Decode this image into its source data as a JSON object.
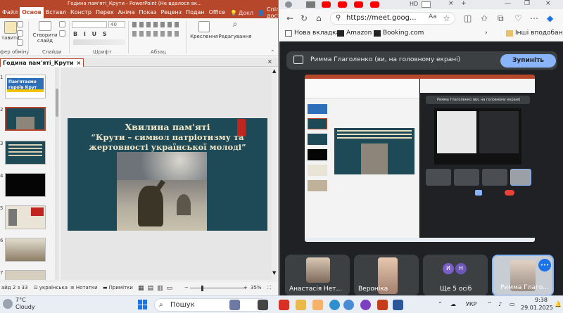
{
  "powerpoint": {
    "window_title": "Година пам'яті_Крути - PowerPoint (Не вдалося ак...",
    "tabs": [
      "Файл",
      "Основ",
      "Вставл",
      "Констр",
      "Перех",
      "Аніма",
      "Показ",
      "Реценз",
      "Подан",
      "Office"
    ],
    "active_tab": "Основ",
    "search_label": "Докл",
    "share_label": "Спільний доступ",
    "ribbon": {
      "paste_label": "тавити",
      "clipboard_label": "фер обміну",
      "new_slide_label": "Створити слайд",
      "slides_group_label": "Слайди",
      "font_group_label": "Шрифт",
      "font_size": "40",
      "paragraph_group_label": "Абзац",
      "drawing_label": "Креслення",
      "editing_label": "Редагування"
    },
    "document_tab": "Година пам'яті_Крути",
    "thumbnails": [
      {
        "num": "1",
        "text": "Пам'ятаємо героїв Крут"
      },
      {
        "num": "2",
        "text": ""
      },
      {
        "num": "3",
        "text": ""
      },
      {
        "num": "4",
        "text": ""
      },
      {
        "num": "5",
        "text": ""
      },
      {
        "num": "6",
        "text": ""
      },
      {
        "num": "7",
        "text": ""
      }
    ],
    "slide": {
      "title_line1": "Хвилина пам'яті",
      "title_line2": "“Крути – символ патріотизму та",
      "title_line3": "жертовності української молоді”"
    },
    "status": {
      "slide_counter": "айд 2 з 33",
      "language": "українська",
      "notes_label": "Нотатки",
      "comments_label": "Примітки",
      "zoom_minus": "−",
      "zoom_plus": "+",
      "zoom": "35%"
    }
  },
  "edge": {
    "url": "https://meet.goog...",
    "tab_badge": "HD",
    "bookmarks": [
      "Нова вкладка",
      "Amazon",
      "Booking.com"
    ],
    "other_bookmarks": "Інші вподобання"
  },
  "meet": {
    "presenting_text": "Римма Глаголенко (ви, на головному екрані)",
    "stop_button": "Зупиніть враження",
    "thumb_presenting_text": "Римма Глаголенко (ви, на головному екрані)",
    "participants": [
      {
        "name": "Анастасія Нет..."
      },
      {
        "name": "Вероніка"
      },
      {
        "name": "Ще 5 осіб",
        "initials": [
          "И",
          "Н"
        ]
      },
      {
        "name": "Римма Глаго..."
      }
    ],
    "controls_label_left": "М",
    "more_options": "•••"
  },
  "taskbar": {
    "temperature": "7°C",
    "weather": "Cloudy",
    "search_placeholder": "Пошук",
    "language": "УКР",
    "time": "9:38",
    "date": "29.01.2025"
  },
  "colors": {
    "ppt_accent": "#b7472a",
    "meet_bg": "#202124",
    "meet_blue": "#8ab4f8",
    "end_call": "#ea4335"
  }
}
